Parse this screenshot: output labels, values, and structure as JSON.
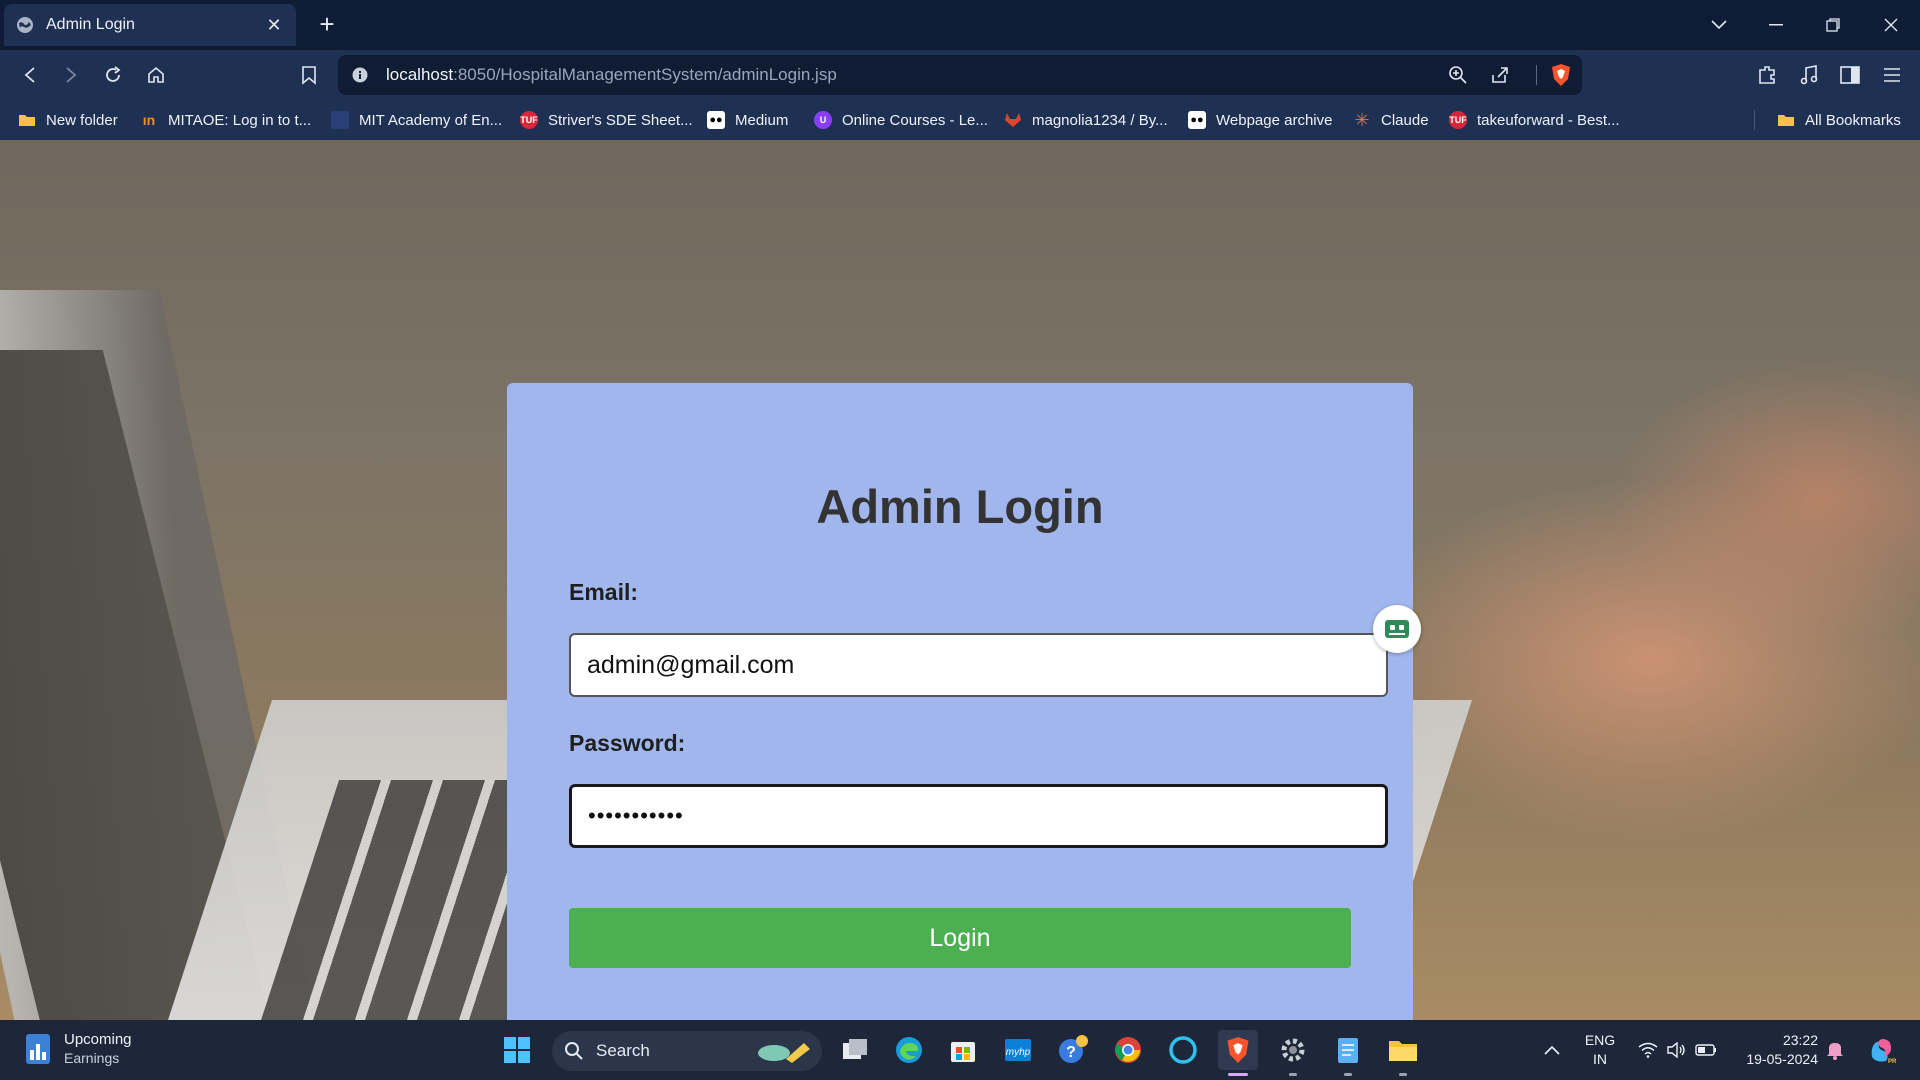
{
  "browser": {
    "tab": {
      "title": "Admin Login",
      "favicon": "globe-icon"
    },
    "url": {
      "host": "localhost",
      "rest": ":8050/HospitalManagementSystem/adminLogin.jsp"
    },
    "bookmarks": [
      {
        "label": "New folder",
        "icon": "folder-icon",
        "color": "#f5c242"
      },
      {
        "label": "MITAOE: Log in to t...",
        "icon": "mitaoe-icon",
        "color": "#f08a24"
      },
      {
        "label": "MIT Academy of En...",
        "icon": "mit-icon",
        "color": "#2a3f7a"
      },
      {
        "label": "Striver's SDE Sheet...",
        "icon": "tuf-icon",
        "color": "#d9263a"
      },
      {
        "label": "Medium",
        "icon": "medium-icon",
        "color": "#000000"
      },
      {
        "label": "Online Courses - Le...",
        "icon": "udemy-icon",
        "color": "#8a3ffc"
      },
      {
        "label": "magnolia1234 / By...",
        "icon": "gitlab-icon",
        "color": "#e2432a"
      },
      {
        "label": "Webpage archive",
        "icon": "medium-icon",
        "color": "#000000"
      },
      {
        "label": "Claude",
        "icon": "claude-icon",
        "color": "#d97757"
      },
      {
        "label": "takeuforward - Best...",
        "icon": "tuf-icon",
        "color": "#d9263a"
      }
    ],
    "all_bookmarks": "All Bookmarks"
  },
  "page": {
    "heading": "Admin Login",
    "email_label": "Email:",
    "email_value": "admin@gmail.com",
    "password_label": "Password:",
    "password_value": "•••••••••••",
    "login_button": "Login"
  },
  "taskbar": {
    "weather_title": "Upcoming",
    "weather_sub": "Earnings",
    "search_placeholder": "Search",
    "lang_top": "ENG",
    "lang_bottom": "IN",
    "time": "23:22",
    "date": "19-05-2024"
  },
  "colors": {
    "card": "#a2b6ee",
    "button": "#4caf50",
    "tabstrip": "#0e1d35",
    "toolbar": "#1e3152"
  }
}
